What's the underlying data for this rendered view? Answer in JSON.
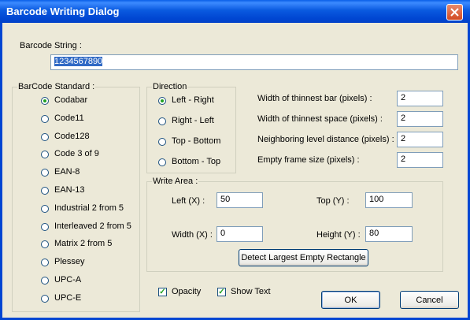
{
  "window": {
    "title": "Barcode Writing Dialog"
  },
  "barcode_string": {
    "label": "Barcode String :",
    "value": "1234567890"
  },
  "standard": {
    "legend": "BarCode Standard :",
    "options": [
      "Codabar",
      "Code11",
      "Code128",
      "Code 3 of 9",
      "EAN-8",
      "EAN-13",
      "Industrial 2 from 5",
      "Interleaved 2 from 5",
      "Matrix 2 from 5",
      "Plessey",
      "UPC-A",
      "UPC-E"
    ],
    "selected": "Codabar"
  },
  "direction": {
    "legend": "Direction",
    "options": [
      "Left - Right",
      "Right - Left",
      "Top - Bottom",
      "Bottom - Top"
    ],
    "selected": "Left - Right"
  },
  "params": [
    {
      "label": "Width of thinnest bar (pixels) :",
      "value": "2"
    },
    {
      "label": "Width of thinnest space (pixels) :",
      "value": "2"
    },
    {
      "label": "Neighboring level distance (pixels) :",
      "value": "2"
    },
    {
      "label": "Empty frame size (pixels) :",
      "value": "2"
    }
  ],
  "write_area": {
    "legend": "Write Area :",
    "left_label": "Left (X) :",
    "left_value": "50",
    "top_label": "Top (Y) :",
    "top_value": "100",
    "width_label": "Width (X) :",
    "width_value": "0",
    "height_label": "Height (Y) :",
    "height_value": "80",
    "detect_label": "Detect Largest Empty Rectangle"
  },
  "options": {
    "opacity_label": "Opacity",
    "opacity_checked": true,
    "show_text_label": "Show Text",
    "show_text_checked": true
  },
  "buttons": {
    "ok": "OK",
    "cancel": "Cancel"
  }
}
